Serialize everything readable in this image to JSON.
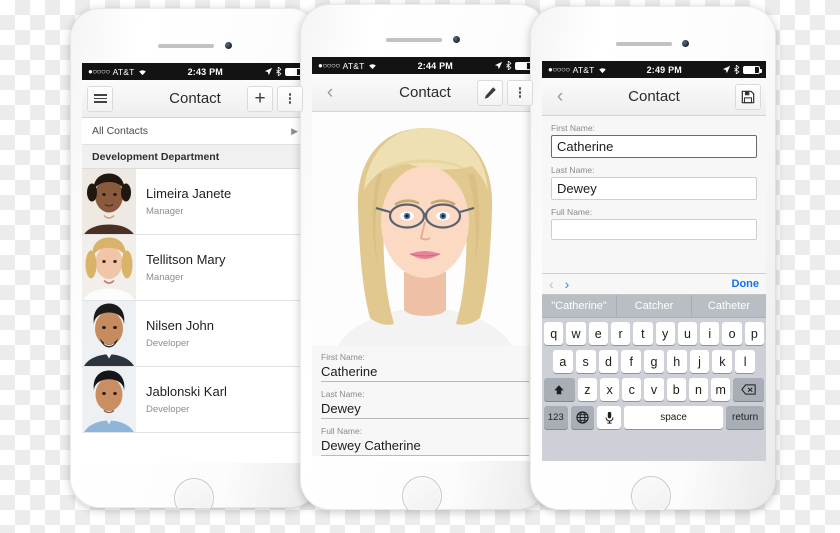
{
  "background": {
    "pattern": "checkerboard-transparency",
    "color_light": "#ffffff",
    "color_dark": "#ececec"
  },
  "accent": {
    "link_blue": "#1273f0",
    "status_bar": "#131313",
    "keyboard_bg": "#cdd0d6"
  },
  "phones": [
    {
      "id": "phone-list",
      "status_bar": {
        "carrier": "AT&T",
        "signal_dots": "●○○○○",
        "wifi_icon": "wifi-icon",
        "time": "2:43 PM",
        "location_icon": "location-arrow-icon",
        "bluetooth_icon": "bluetooth-icon",
        "battery_icon": "battery-icon"
      },
      "navbar": {
        "menu_icon": "hamburger-menu-icon",
        "title": "Contact",
        "add_icon": "plus-icon",
        "overflow_icon": "kebab-menu-icon"
      },
      "list": {
        "all_contacts_label": "All Contacts",
        "all_contacts_chevron": "chevron-right-icon",
        "section_header": "Development Department",
        "contacts": [
          {
            "name": "Limeira Janete",
            "role": "Manager",
            "avatar": "avatar-woman-dark-hair"
          },
          {
            "name": "Tellitson Mary",
            "role": "Manager",
            "avatar": "avatar-woman-blonde"
          },
          {
            "name": "Nilsen John",
            "role": "Developer",
            "avatar": "avatar-man-beard"
          },
          {
            "name": "Jablonski Karl",
            "role": "Developer",
            "avatar": "avatar-man-blue-shirt"
          }
        ]
      }
    },
    {
      "id": "phone-detail",
      "status_bar": {
        "carrier": "AT&T",
        "signal_dots": "●○○○○",
        "wifi_icon": "wifi-icon",
        "time": "2:44 PM",
        "location_icon": "location-arrow-icon",
        "bluetooth_icon": "bluetooth-icon",
        "battery_icon": "battery-icon"
      },
      "navbar": {
        "back_icon": "chevron-left-icon",
        "title": "Contact",
        "edit_icon": "pencil-edit-icon",
        "overflow_icon": "kebab-menu-icon"
      },
      "photo": "contact-photo-blonde-woman-glasses",
      "fields": [
        {
          "label": "First Name:",
          "value": "Catherine"
        },
        {
          "label": "Last Name:",
          "value": "Dewey"
        },
        {
          "label": "Full Name:",
          "value": "Dewey Catherine"
        }
      ]
    },
    {
      "id": "phone-edit",
      "status_bar": {
        "carrier": "AT&T",
        "signal_dots": "●○○○○",
        "wifi_icon": "wifi-icon",
        "time": "2:49 PM",
        "location_icon": "location-arrow-icon",
        "bluetooth_icon": "bluetooth-icon",
        "battery_icon": "battery-icon"
      },
      "navbar": {
        "back_icon": "chevron-left-icon",
        "title": "Contact",
        "save_icon": "save-floppy-disk-icon"
      },
      "fields": [
        {
          "label": "First Name:",
          "value": "Catherine",
          "focused": true
        },
        {
          "label": "Last Name:",
          "value": "Dewey",
          "focused": false
        },
        {
          "label": "Full Name:",
          "value": "",
          "focused": false
        }
      ],
      "keyboard": {
        "toolbar": {
          "prev_icon": "chevron-left-icon",
          "next_icon": "chevron-right-icon",
          "done_label": "Done"
        },
        "suggestions": [
          "\"Catherine\"",
          "Catcher",
          "Catheter"
        ],
        "row1": [
          "q",
          "w",
          "e",
          "r",
          "t",
          "y",
          "u",
          "i",
          "o",
          "p"
        ],
        "row2": [
          "a",
          "s",
          "d",
          "f",
          "g",
          "h",
          "j",
          "k",
          "l"
        ],
        "row3": [
          "z",
          "x",
          "c",
          "v",
          "b",
          "n",
          "m"
        ],
        "shift_icon": "shift-arrow-icon",
        "backspace_icon": "backspace-delete-icon",
        "numeric_label": "123",
        "globe_icon": "globe-language-icon",
        "mic_icon": "microphone-icon",
        "space_label": "space",
        "return_label": "return"
      }
    }
  ]
}
